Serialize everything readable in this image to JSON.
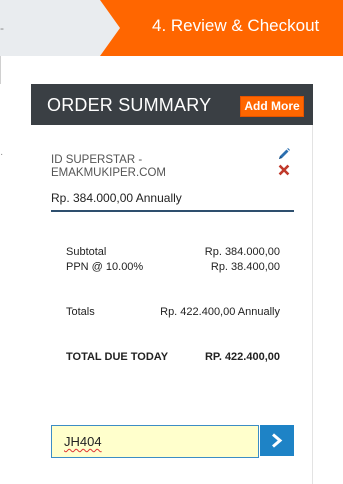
{
  "steps": {
    "prev_mark": "-",
    "current_label": "4. Review & Checkout"
  },
  "order_summary": {
    "title": "ORDER SUMMARY",
    "add_more_label": "Add More",
    "product": {
      "name": "ID SUPERSTAR -\nEMAKMUKIPER.COM",
      "price": "Rp. 384.000,00 Annually",
      "icons": [
        "pencil-icon",
        "close-icon"
      ]
    },
    "subtotal": {
      "label": "Subtotal",
      "value": "Rp. 384.000,00"
    },
    "tax": {
      "label": "PPN @ 10.00%",
      "value": "Rp. 38.400,00"
    },
    "totals": {
      "label": "Totals",
      "value": "Rp. 422.400,00 Annually"
    },
    "total_due": {
      "label": "TOTAL DUE TODAY",
      "value": "RP. 422.400,00"
    }
  },
  "promo": {
    "value": "JH404",
    "submit_icon": "chevron-right-icon"
  },
  "colors": {
    "accent": "#ff6600",
    "header_bg": "#3a3f44",
    "button_blue": "#1e83c6",
    "input_bg": "#ffffcc"
  }
}
